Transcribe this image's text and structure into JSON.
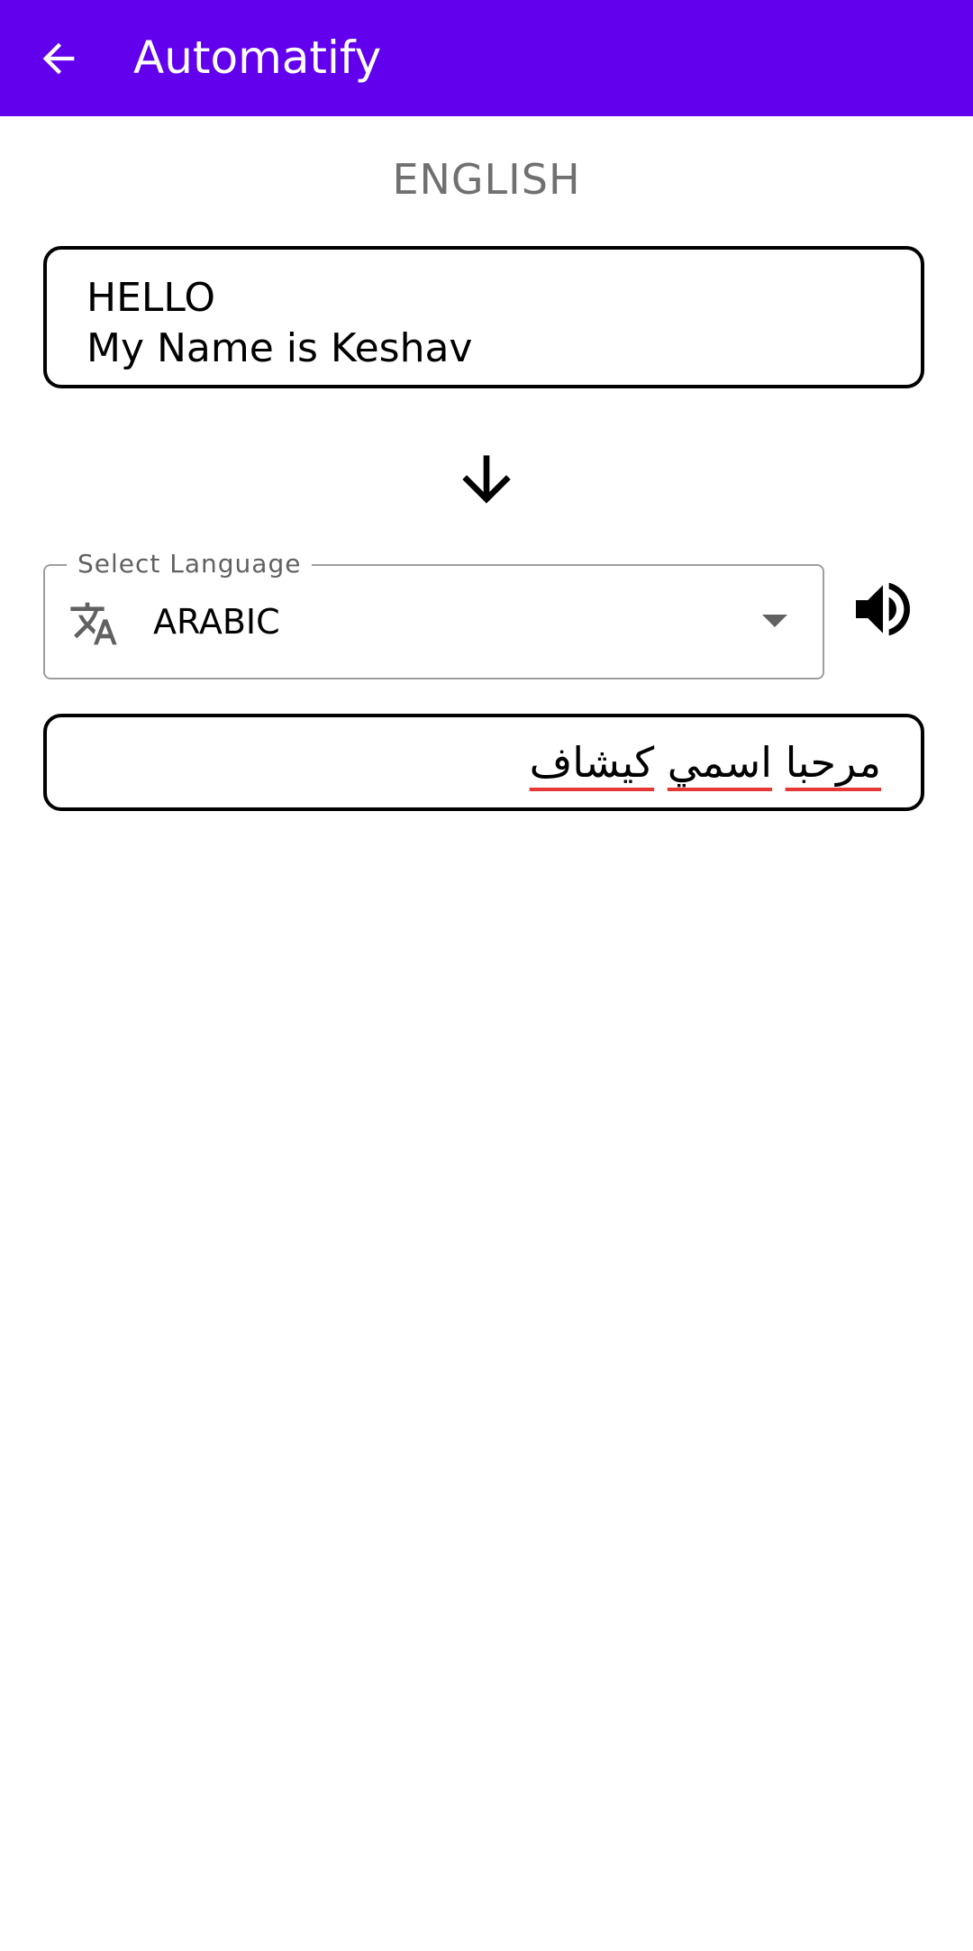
{
  "appbar": {
    "title": "Automatify",
    "back_icon": "arrow-back-icon",
    "color": "#6200ee"
  },
  "source": {
    "language": "ENGLISH",
    "text": "HELLO\nMy Name is Keshav"
  },
  "direction_icon": "arrow-down-icon",
  "language_select": {
    "label": "Select Language",
    "value": "ARABIC",
    "icon": "translate-icon"
  },
  "speaker_icon": "volume-up-icon",
  "result": {
    "words": [
      "مرحبا",
      "اسمي",
      "كيشاف"
    ]
  }
}
